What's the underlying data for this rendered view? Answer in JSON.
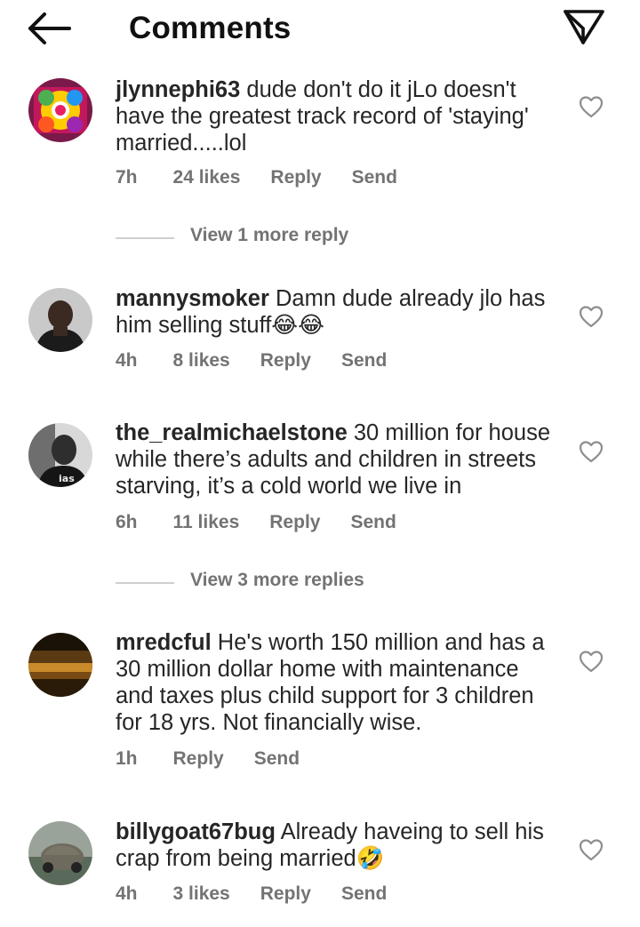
{
  "header": {
    "title": "Comments",
    "back_icon": "arrow-left-icon",
    "share_icon": "paper-plane-icon"
  },
  "colors": {
    "text": "#262626",
    "meta": "#737373",
    "divider": "#cfcfcf"
  },
  "comments": [
    {
      "username": "jlynnephi63",
      "text": "dude don't do it jLo doesn't have the greatest track record of 'staying' married.....lol",
      "time": "7h",
      "likes": "24 likes",
      "reply": "Reply",
      "send": "Send",
      "view_replies": "View 1 more reply"
    },
    {
      "username": "mannysmoker",
      "text": "Damn dude already jlo has him selling stuff",
      "emoji": "😂😂",
      "time": "4h",
      "likes": "8 likes",
      "reply": "Reply",
      "send": "Send"
    },
    {
      "username": "the_realmichaelstone",
      "text": "30 million for house while there’s adults and children in streets starving, it’s a cold world we live in",
      "time": "6h",
      "likes": "11 likes",
      "reply": "Reply",
      "send": "Send",
      "view_replies": "View 3 more replies"
    },
    {
      "username": "mredcful",
      "text": "He's worth 150 million and has a 30 million dollar home with maintenance and taxes plus child support for 3 children for 18 yrs. Not financially wise.",
      "time": "1h",
      "reply": "Reply",
      "send": "Send"
    },
    {
      "username": "billygoat67bug",
      "text": "Already haveing to sell his crap from being married",
      "emoji": "🤣",
      "time": "4h",
      "likes": "3 likes",
      "reply": "Reply",
      "send": "Send"
    }
  ]
}
